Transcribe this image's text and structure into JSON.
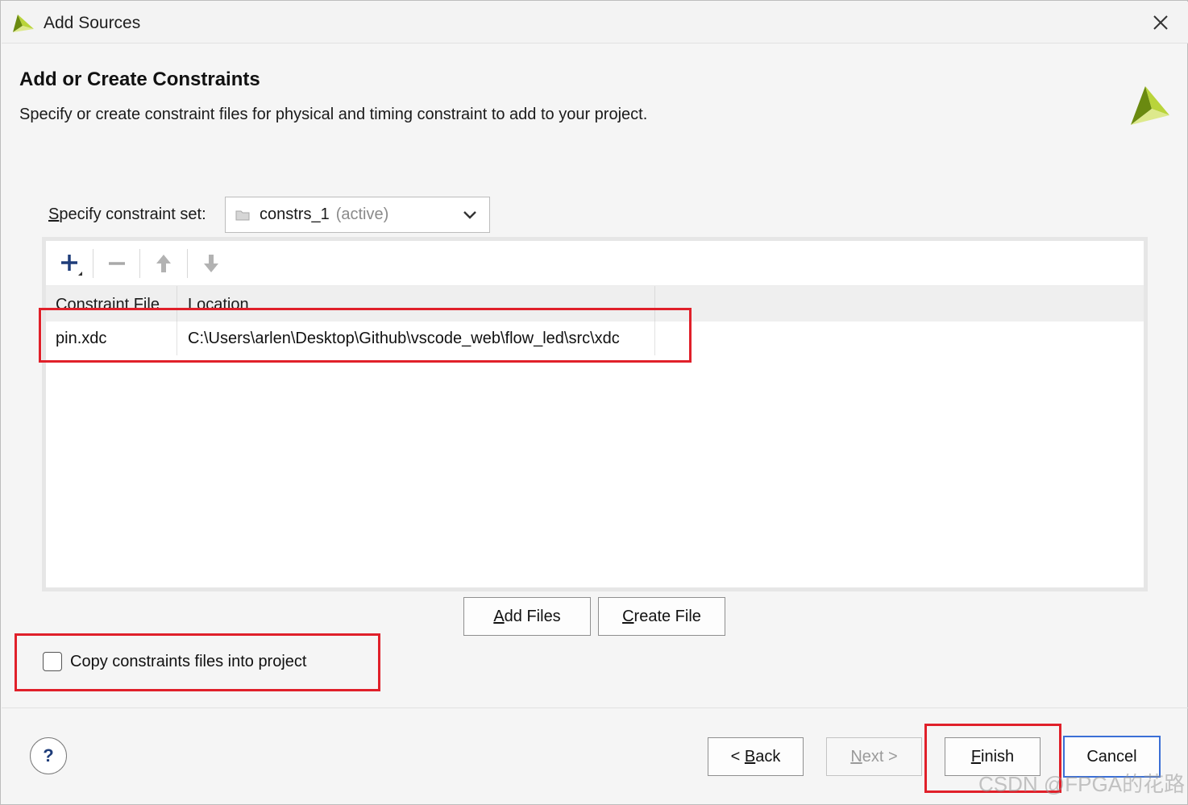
{
  "window": {
    "title": "Add Sources",
    "close_label": "✕"
  },
  "header": {
    "heading": "Add or Create Constraints",
    "description": "Specify or create constraint files for physical and timing constraint to add to your project."
  },
  "constraint_set": {
    "label": "Specify constraint set:",
    "value": "constrs_1",
    "status": "(active)"
  },
  "toolbar": {
    "add_icon": "plus-icon",
    "remove_icon": "minus-icon",
    "up_icon": "arrow-up-icon",
    "down_icon": "arrow-down-icon"
  },
  "table": {
    "columns": [
      "Constraint File",
      "Location"
    ],
    "rows": [
      {
        "file": "pin.xdc",
        "location": "C:\\Users\\arlen\\Desktop\\Github\\vscode_web\\flow_led\\src\\xdc"
      }
    ]
  },
  "actions": {
    "add_files": "Add Files",
    "create_file": "Create File"
  },
  "copy_option": {
    "label": "Copy constraints files into project",
    "checked": false
  },
  "footer": {
    "help": "?",
    "back": "< Back",
    "next": "Next >",
    "finish": "Finish",
    "cancel": "Cancel"
  },
  "colors": {
    "highlight": "#e0202a",
    "focus": "#3b6fd6",
    "logo_green": "#8db31a"
  },
  "watermark": "CSDN @FPGA的花路"
}
